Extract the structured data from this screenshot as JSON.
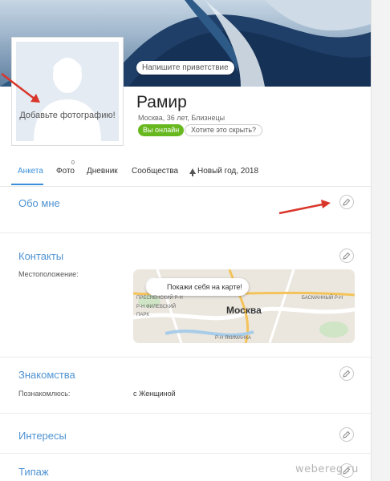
{
  "cover": {
    "greeting_button": "Напишите приветствие"
  },
  "avatar": {
    "placeholder_text": "Добавьте фотографию!"
  },
  "profile": {
    "name": "Рамир",
    "meta": "Москва, 36 лет, Близнецы",
    "online_badge": "Вы онлайн",
    "hide_link": "Хотите это скрыть?"
  },
  "tabs": [
    {
      "label": "Анкета",
      "active": true
    },
    {
      "label": "Фото",
      "badge": "0"
    },
    {
      "label": "Дневник"
    },
    {
      "label": "Сообщества"
    },
    {
      "label": "Новый год, 2018"
    }
  ],
  "sections": {
    "about": {
      "title": "Обо мне"
    },
    "contacts": {
      "title": "Контакты",
      "location_label": "Местоположение:",
      "map_button": "Покажи себя на карте!",
      "map_city": "Москва",
      "map_districts": [
        "ПРЕСНЕНСКИЙ Р-Н",
        "БАСМАННЫЙ Р-Н",
        "Р-Н ФИЛЕВСКИЙ",
        "ПАРК",
        "Р-Н ЯКИМАНКА"
      ]
    },
    "dating": {
      "title": "Знакомства",
      "label": "Познакомлюсь:",
      "value": "с Женщиной"
    },
    "interests": {
      "title": "Интересы"
    },
    "type": {
      "title": "Типаж"
    }
  },
  "watermark": "webereg.ru",
  "colors": {
    "accent": "#3a8fd8",
    "online": "#67b81f",
    "arrow": "#d9362b"
  }
}
